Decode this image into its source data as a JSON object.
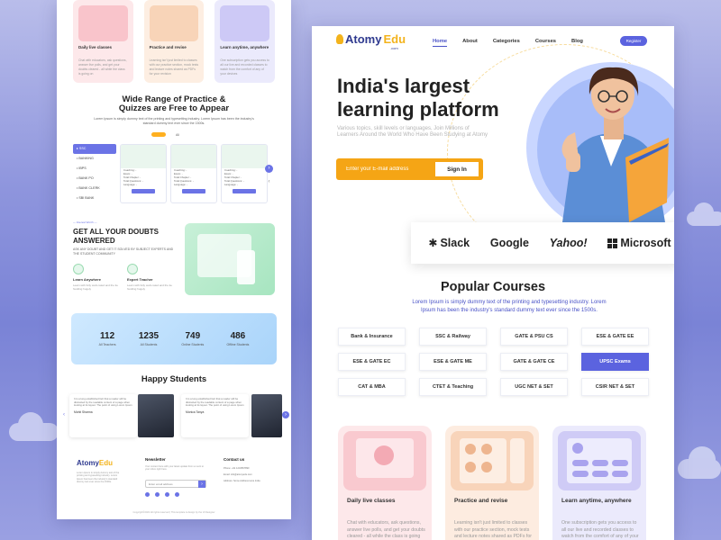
{
  "left_page": {
    "mini_cards": [
      {
        "title": "Daily live classes",
        "desc": "Chat with educators, ask questions, answer live polls, and get your doubts cleared - all while the class is going on"
      },
      {
        "title": "Practice and revise",
        "desc": "Learning isn't just limited to classes with our practice section, mock tests and lecture notes shared as PDFs for your revision"
      },
      {
        "title": "Learn anytime, anywhere",
        "desc": "One subscription gets you access to all our live and recorded classes to watch from the comfort of any of your devices"
      }
    ],
    "quiz_heading": "Wide Range of Practice & Quizzes are Free to Appear",
    "quiz_sub": "Lorem Ipsum is simply dummy text of the printing and typesetting industry. Lorem Ipsum has been the industry's standard dummy text ever since the 1500s.",
    "quiz_tabs": [
      "",
      "All"
    ],
    "quiz_side": [
      "SSC",
      "BANKING",
      "IBPS",
      "BANK PO",
      "BANK CLERK",
      "SBI BANK"
    ],
    "quiz_card_lines": [
      "Coaching: -",
      "Exam: -",
      "Total Chapter: -",
      "Total Questions: -",
      "Language: -"
    ],
    "doubts": {
      "kicker": "— Interest Worth —",
      "title": "GET ALL YOUR DOUBTS ANSWERED",
      "desc": "ASK ANY DOUBT AND GET IT SOLVED BY SUBJECT EXPERTS AND THE STUDENT COMMUNITY",
      "features": [
        {
          "title": "Learn Anywhere",
          "desc": "Learn with fully work-rated and the tie hustling hugely"
        },
        {
          "title": "Expert Teacher",
          "desc": "Learn with fully work-rated and the tie hustling hugely"
        }
      ]
    },
    "stats": [
      {
        "value": "112",
        "label": "All Teachers"
      },
      {
        "value": "1235",
        "label": "All Students"
      },
      {
        "value": "749",
        "label": "Online Students"
      },
      {
        "value": "486",
        "label": "Offline Students"
      }
    ],
    "testimonials_heading": "Happy Students",
    "testimonials": [
      {
        "text": "It is a long established fact that a reader will be distracted by the readable content of a page when looking at its layout. The point of using Lorem Ipsum",
        "name": "Mohit Sharma"
      },
      {
        "text": "It is a long established fact that a reader will be distracted by the readable content of a page when looking at its layout. The point of using Lorem Ipsum",
        "name": "Monica Tanya"
      }
    ],
    "footer": {
      "logo_a": "Atomy",
      "logo_b": "Edu",
      "about": "Lorem Ipsum is simply dummy text of the printing and typesetting industry. Lorem Ipsum has been the industry's standard dummy text ever since the 1500s.",
      "newsletter_title": "Newsletter",
      "newsletter_text": "Your content here with your latest update from us sent to your inbox right here.",
      "email_placeholder": "Enter email address",
      "contact_title": "Contact us",
      "contact_lines": [
        "Phone: +91 1234567890",
        "Email: info@atomyedu.com",
        "Address: Some Address Here India"
      ],
      "copyright": "Copyright©2021 All rights reserved | This template is design by the UI Designer"
    }
  },
  "nav": {
    "logo_a": "Atomy",
    "logo_b": "Edu",
    "logo_sub": ".com",
    "links": [
      "Home",
      "About",
      "Categories",
      "Courses",
      "Blog"
    ],
    "active_link": "Home",
    "register": "Register"
  },
  "hero": {
    "title": "India's largest learning platform",
    "subtitle": "Various topics, skill levels or languages, Join Millions of Learners Around the World Who Have Been Studying at Atomy",
    "email_placeholder": "Enter your E-mail address",
    "signin": "Sign In"
  },
  "brands": [
    "Slack",
    "Google",
    "Yahoo!",
    "Microsoft"
  ],
  "courses": {
    "title": "Popular Courses",
    "subtitle": "Lorem Ipsum is simply dummy text of the printing and typesetting industry. Lorem Ipsum has been the industry's standard dummy text ever since the 1500s.",
    "items": [
      "Bank & Insurance",
      "SSC & Railway",
      "GATE & PSU CS",
      "ESE & GATE EE",
      "ESE & GATE EC",
      "ESE & GATE ME",
      "GATE & GATE CE",
      "UPSC Exams",
      "CAT & MBA",
      "CTET & Teaching",
      "UGC NET & SET",
      "CSIR NET & SET"
    ],
    "active": "UPSC Exams"
  },
  "features": [
    {
      "title": "Daily live classes",
      "desc": "Chat with educators, ask questions, answer live polls, and get your doubts cleared - all while the class is going on"
    },
    {
      "title": "Practice and revise",
      "desc": "Learning isn't just limited to classes with our practice section, mock tests and lecture notes shared as PDFs for your revision"
    },
    {
      "title": "Learn anytime, anywhere",
      "desc": "One subscription gets you access to all our live and recorded classes to watch from the comfort of any of your devices"
    }
  ],
  "colors": {
    "accent": "#5b63df",
    "orange": "#f5a515",
    "navy": "#2f3a8f",
    "yellow": "#f3b31c"
  }
}
